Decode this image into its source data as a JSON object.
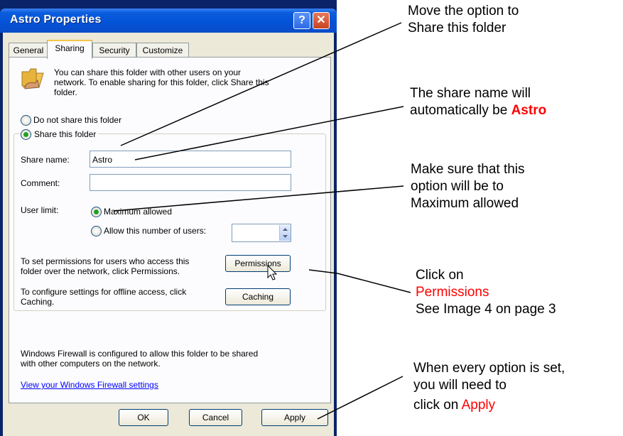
{
  "window": {
    "title": "Astro Properties",
    "help_glyph": "?",
    "close_glyph": "✕"
  },
  "tabs": [
    "General",
    "Sharing",
    "Security",
    "Customize"
  ],
  "active_tab": "Sharing",
  "sharing": {
    "intro_line1": "You can share this folder with other users on your",
    "intro_line2": "network.  To enable sharing for this folder, click Share this",
    "intro_line3": "folder.",
    "do_not_share_label": "Do not share this folder",
    "share_label": "Share this folder",
    "share_selected": true,
    "share_name_label": "Share name:",
    "share_name_value": "Astro",
    "comment_label": "Comment:",
    "comment_value": "",
    "user_limit_label": "User limit:",
    "max_allowed_label": "Maximum allowed",
    "max_allowed_selected": true,
    "allow_number_label": "Allow this number of users:",
    "allow_number_value": "",
    "permissions_text_line1": "To set permissions for users who access this",
    "permissions_text_line2": "folder over the network, click Permissions.",
    "permissions_button": "Permissions",
    "caching_text_line1": "To configure settings for offline access, click",
    "caching_text_line2": "Caching.",
    "caching_button": "Caching",
    "firewall_line1": "Windows Firewall is configured to allow this folder to be shared",
    "firewall_line2": "with other computers on the network.",
    "firewall_link": "View your Windows Firewall settings"
  },
  "footer": {
    "ok": "OK",
    "cancel": "Cancel",
    "apply": "Apply"
  },
  "annotations": {
    "a1_line1": "Move the option to",
    "a1_line2": "Share this folder",
    "a2_line1": "The share name will",
    "a2_line2_prefix": "automatically be ",
    "a2_line2_red": "Astro",
    "a3_line1": "Make  sure that this",
    "a3_line2": "option will be to",
    "a3_line3": "Maximum allowed",
    "a4_line1": "Click on",
    "a4_line2_red": "Permissions",
    "a4_line3": "See Image 4 on page 3",
    "a5_line1": "When every option  is set,",
    "a5_line2": "you will need to",
    "a5_line3_prefix": "click on ",
    "a5_line3_red": "Apply"
  },
  "colors": {
    "titlebar": "#0352d6",
    "highlight_red": "#ff0000",
    "radio_selected": "#21a121",
    "link": "#0000ff"
  }
}
